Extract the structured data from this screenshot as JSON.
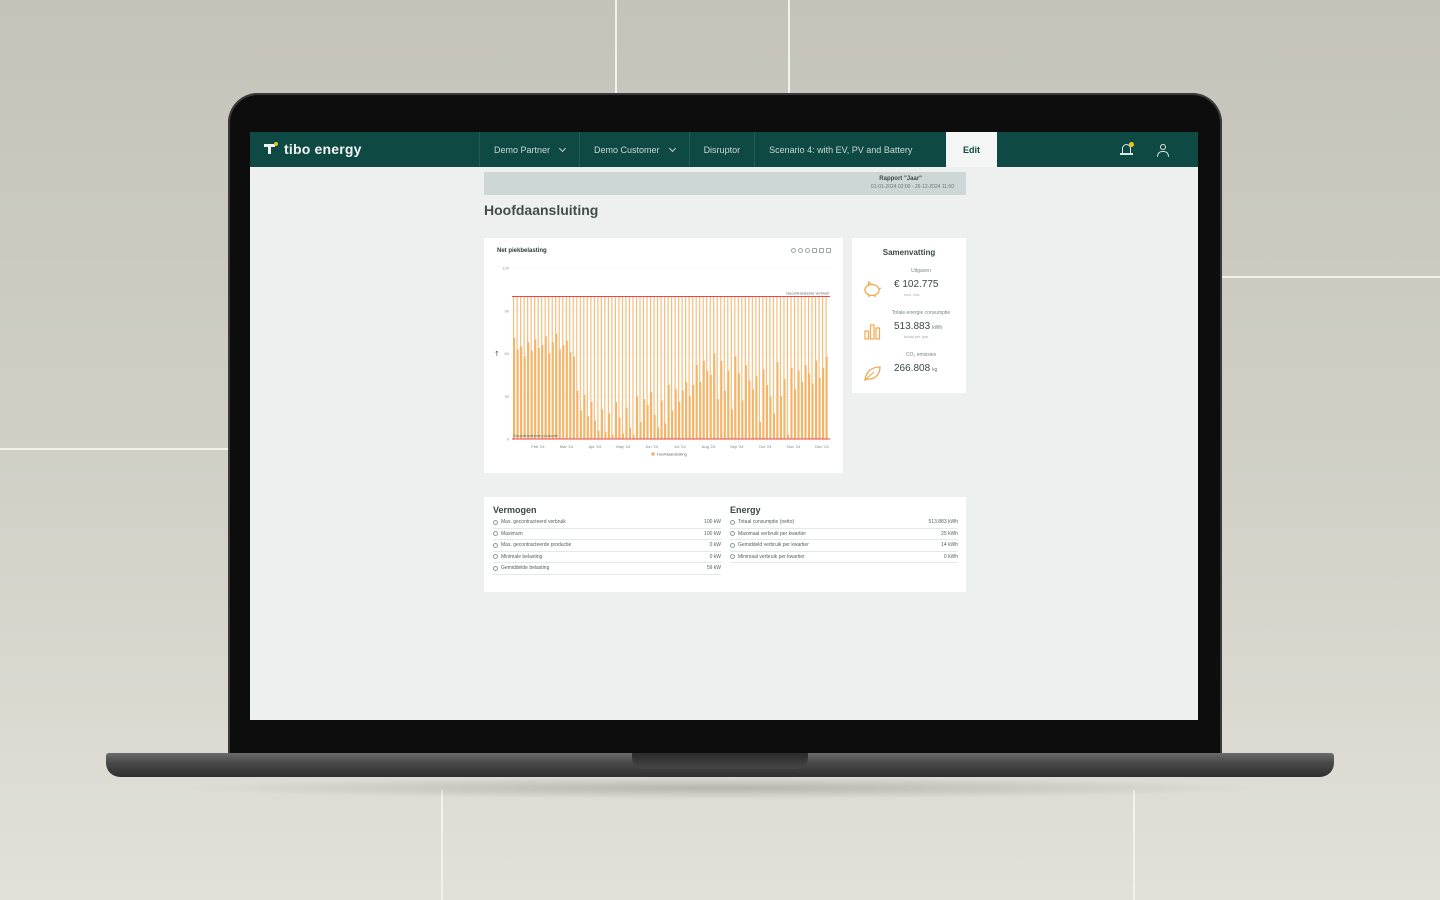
{
  "app": {
    "brand": "tibo energy"
  },
  "nav": {
    "tabs": [
      {
        "label": "Demo Partner",
        "dropdown": true
      },
      {
        "label": "Demo Customer",
        "dropdown": true
      },
      {
        "label": "Disruptor",
        "dropdown": false
      },
      {
        "label": "Scenario 4: with EV, PV and Battery",
        "dropdown": false
      }
    ],
    "edit_label": "Edit",
    "bell_icon": "bell-icon",
    "user_icon": "user-icon"
  },
  "report": {
    "title": "Rapport \"Jaar\"",
    "range": "01-01-2024 02:00 - 26-12-2024 11:00"
  },
  "page": {
    "title": "Hoofdaansluiting"
  },
  "chart_data": {
    "type": "bar",
    "title": "Net piekbelasting",
    "ylabel": "",
    "y_ticks": [
      "120",
      "90",
      "60",
      "30",
      "0"
    ],
    "ylim": [
      0,
      120
    ],
    "x_ticks": [
      "Feb '24",
      "Mar '24",
      "Apr '24",
      "May '24",
      "Jun '24",
      "Jul '24",
      "Aug '24",
      "Sep '24",
      "Oct '24",
      "Nov '24",
      "Dec '24"
    ],
    "series": [
      {
        "name": "Hoofdaansluiting",
        "color": "#f5b366",
        "values": [
          71,
          63,
          65,
          58,
          68,
          62,
          70,
          64,
          66,
          72,
          60,
          68,
          74,
          63,
          66,
          69,
          61,
          58,
          34,
          20,
          31,
          16,
          26,
          13,
          6,
          21,
          5,
          18,
          3,
          26,
          15,
          4,
          22,
          8,
          3,
          30,
          12,
          28,
          24,
          33,
          17,
          8,
          27,
          11,
          38,
          20,
          35,
          26,
          34,
          40,
          30,
          38,
          52,
          40,
          55,
          48,
          45,
          60,
          28,
          55,
          34,
          48,
          21,
          58,
          46,
          27,
          52,
          41,
          35,
          44,
          12,
          49,
          38,
          30,
          18,
          54,
          30,
          42,
          3,
          50,
          35,
          48,
          40,
          52,
          46,
          39,
          55,
          43,
          50,
          58
        ]
      }
    ],
    "annotations": [
      {
        "label": "Gecontracteerde verbruik",
        "value": 100,
        "color": "#e5464a"
      },
      {
        "label": "Gecontracteerde productie",
        "value": 0,
        "color": "#e5464a"
      }
    ],
    "legend": "bottom-center",
    "grid": true
  },
  "summary": {
    "title": "Samenvatting",
    "items": [
      {
        "label": "Uitgaven",
        "value": "€ 102.775",
        "unit": "",
        "sub": "excl. btw",
        "icon": "piggy-bank-icon"
      },
      {
        "label": "Totale energie consumptie",
        "value": "513.883",
        "unit": "kWh",
        "sub": "totaal per jaar",
        "icon": "bar-chart-icon"
      },
      {
        "label": "CO₂ emissies",
        "value": "266.808",
        "unit": "kg",
        "sub": "",
        "icon": "leaf-icon"
      }
    ]
  },
  "vermogen": {
    "title": "Vermogen",
    "rows": [
      {
        "label": "Max. gecontracteerd verbruik",
        "value": "100 kW"
      },
      {
        "label": "Maximum",
        "value": "100 kW"
      },
      {
        "label": "Max. gecontracteerde productie",
        "value": "0 kW"
      },
      {
        "label": "Minimale belasting",
        "value": "0 kW"
      },
      {
        "label": "Gemiddelde belasting",
        "value": "59 kW"
      }
    ]
  },
  "energy": {
    "title": "Energy",
    "rows": [
      {
        "label": "Totaal consumptie (netto)",
        "value": "513.883 kWh"
      },
      {
        "label": "Maximaal verbruik per kwartier",
        "value": "25 kWh"
      },
      {
        "label": "Gemiddeld verbruik per kwartier",
        "value": "14 kWh"
      },
      {
        "label": "Minimaal verbruik per kwartier",
        "value": "0 kWh"
      }
    ]
  }
}
